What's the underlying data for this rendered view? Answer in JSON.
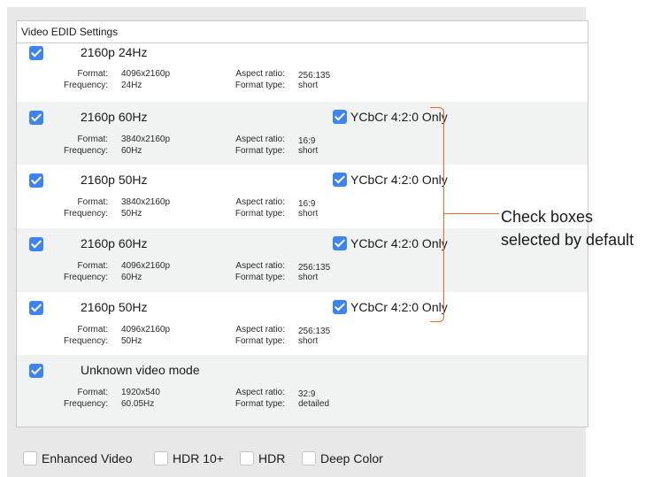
{
  "panel_title": "Video EDID Settings",
  "field_labels": {
    "format": "Format:",
    "frequency": "Frequency:",
    "aspect_ratio": "Aspect ratio:",
    "format_type": "Format type:"
  },
  "modes": [
    {
      "name": "2160p 24Hz",
      "checked": true,
      "format": "4096x2160p",
      "frequency": "24Hz",
      "aspect_ratio": "256:135",
      "format_type": "short",
      "ycbcr": null
    },
    {
      "name": "2160p 60Hz",
      "checked": true,
      "format": "3840x2160p",
      "frequency": "60Hz",
      "aspect_ratio": "16:9",
      "format_type": "short",
      "ycbcr": "YCbCr 4:2:0 Only"
    },
    {
      "name": "2160p 50Hz",
      "checked": true,
      "format": "3840x2160p",
      "frequency": "50Hz",
      "aspect_ratio": "16:9",
      "format_type": "short",
      "ycbcr": "YCbCr 4:2:0 Only"
    },
    {
      "name": "2160p 60Hz",
      "checked": true,
      "format": "4096x2160p",
      "frequency": "60Hz",
      "aspect_ratio": "256:135",
      "format_type": "short",
      "ycbcr": "YCbCr 4:2:0 Only"
    },
    {
      "name": "2160p 50Hz",
      "checked": true,
      "format": "4096x2160p",
      "frequency": "50Hz",
      "aspect_ratio": "256:135",
      "format_type": "short",
      "ycbcr": "YCbCr 4:2:0 Only"
    },
    {
      "name": "Unknown video mode",
      "checked": true,
      "format": "1920x540",
      "frequency": "60.05Hz",
      "aspect_ratio": "32:9",
      "format_type": "detailed",
      "ycbcr": null
    }
  ],
  "options": [
    {
      "label": "Enhanced Video",
      "checked": false
    },
    {
      "label": "HDR 10+",
      "checked": false
    },
    {
      "label": "HDR",
      "checked": false
    },
    {
      "label": "Deep Color",
      "checked": false
    }
  ],
  "annotation": {
    "line1": "Check boxes",
    "line2": "selected by default",
    "color": "#e8692d"
  },
  "colors": {
    "checkbox_on": "#3d84f0",
    "panel_bg": "#e8e8e8",
    "row_alt": "#f0f3f1"
  }
}
